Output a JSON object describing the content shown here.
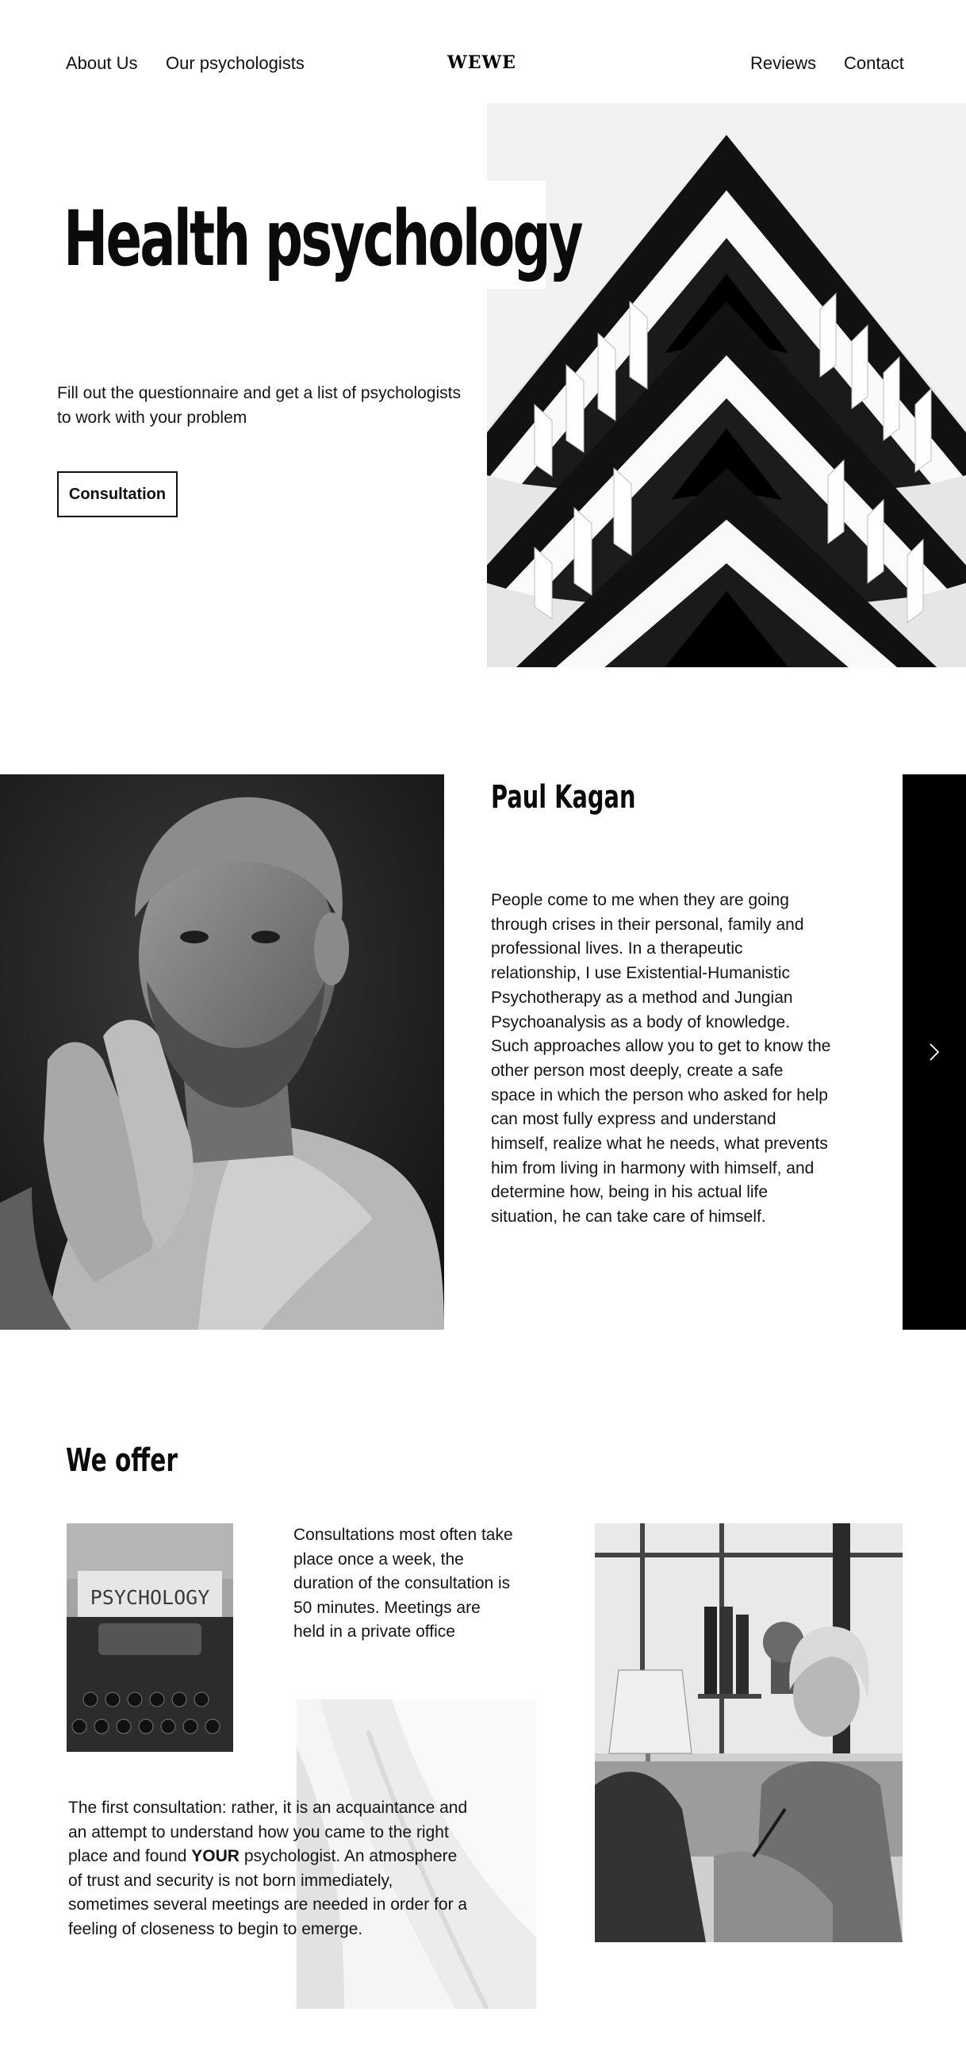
{
  "header": {
    "nav_left": [
      "About Us",
      "Our psychologists"
    ],
    "logo": "WEWE",
    "nav_right": [
      "Reviews",
      "Contact"
    ]
  },
  "hero": {
    "title": "Health psychology",
    "subtitle": "Fill out the questionnaire and get a list of psychologists to work with your problem",
    "cta_label": "Consultation"
  },
  "profile": {
    "name": "Paul Kagan",
    "bio": "People come to me when they are going through crises in their personal, family and professional lives. In a therapeutic relationship, I use Existential-Humanistic Psychotherapy as a method and Jungian Psychoanalysis as a body of knowledge. Such approaches allow you to get to know the other person most deeply, create a safe space in which the person who asked for help can most fully express and understand himself, realize what he needs, what prevents him from living in harmony with himself, and determine how, being in his actual life situation, he can take care of himself.",
    "next_icon": "chevron-right-icon"
  },
  "offer": {
    "title": "We offer",
    "text1": "Consultations most often take place once a week, the duration of the consultation is 50 minutes. Meetings are held in a private office",
    "text2_before": "The first consultation: rather, it is an acquaintance and an attempt to understand how you came to the right place and found ",
    "text2_bold": "YOUR",
    "text2_after": " psychologist. An atmosphere of trust and security is not born immediately, sometimes several meetings are needed in order for a feeling of closeness to begin to emerge.",
    "typewriter_label": "PSYCHOLOGY"
  },
  "colors": {
    "background": "#ffffff",
    "text": "#111111",
    "accent_panel": "#000000"
  }
}
